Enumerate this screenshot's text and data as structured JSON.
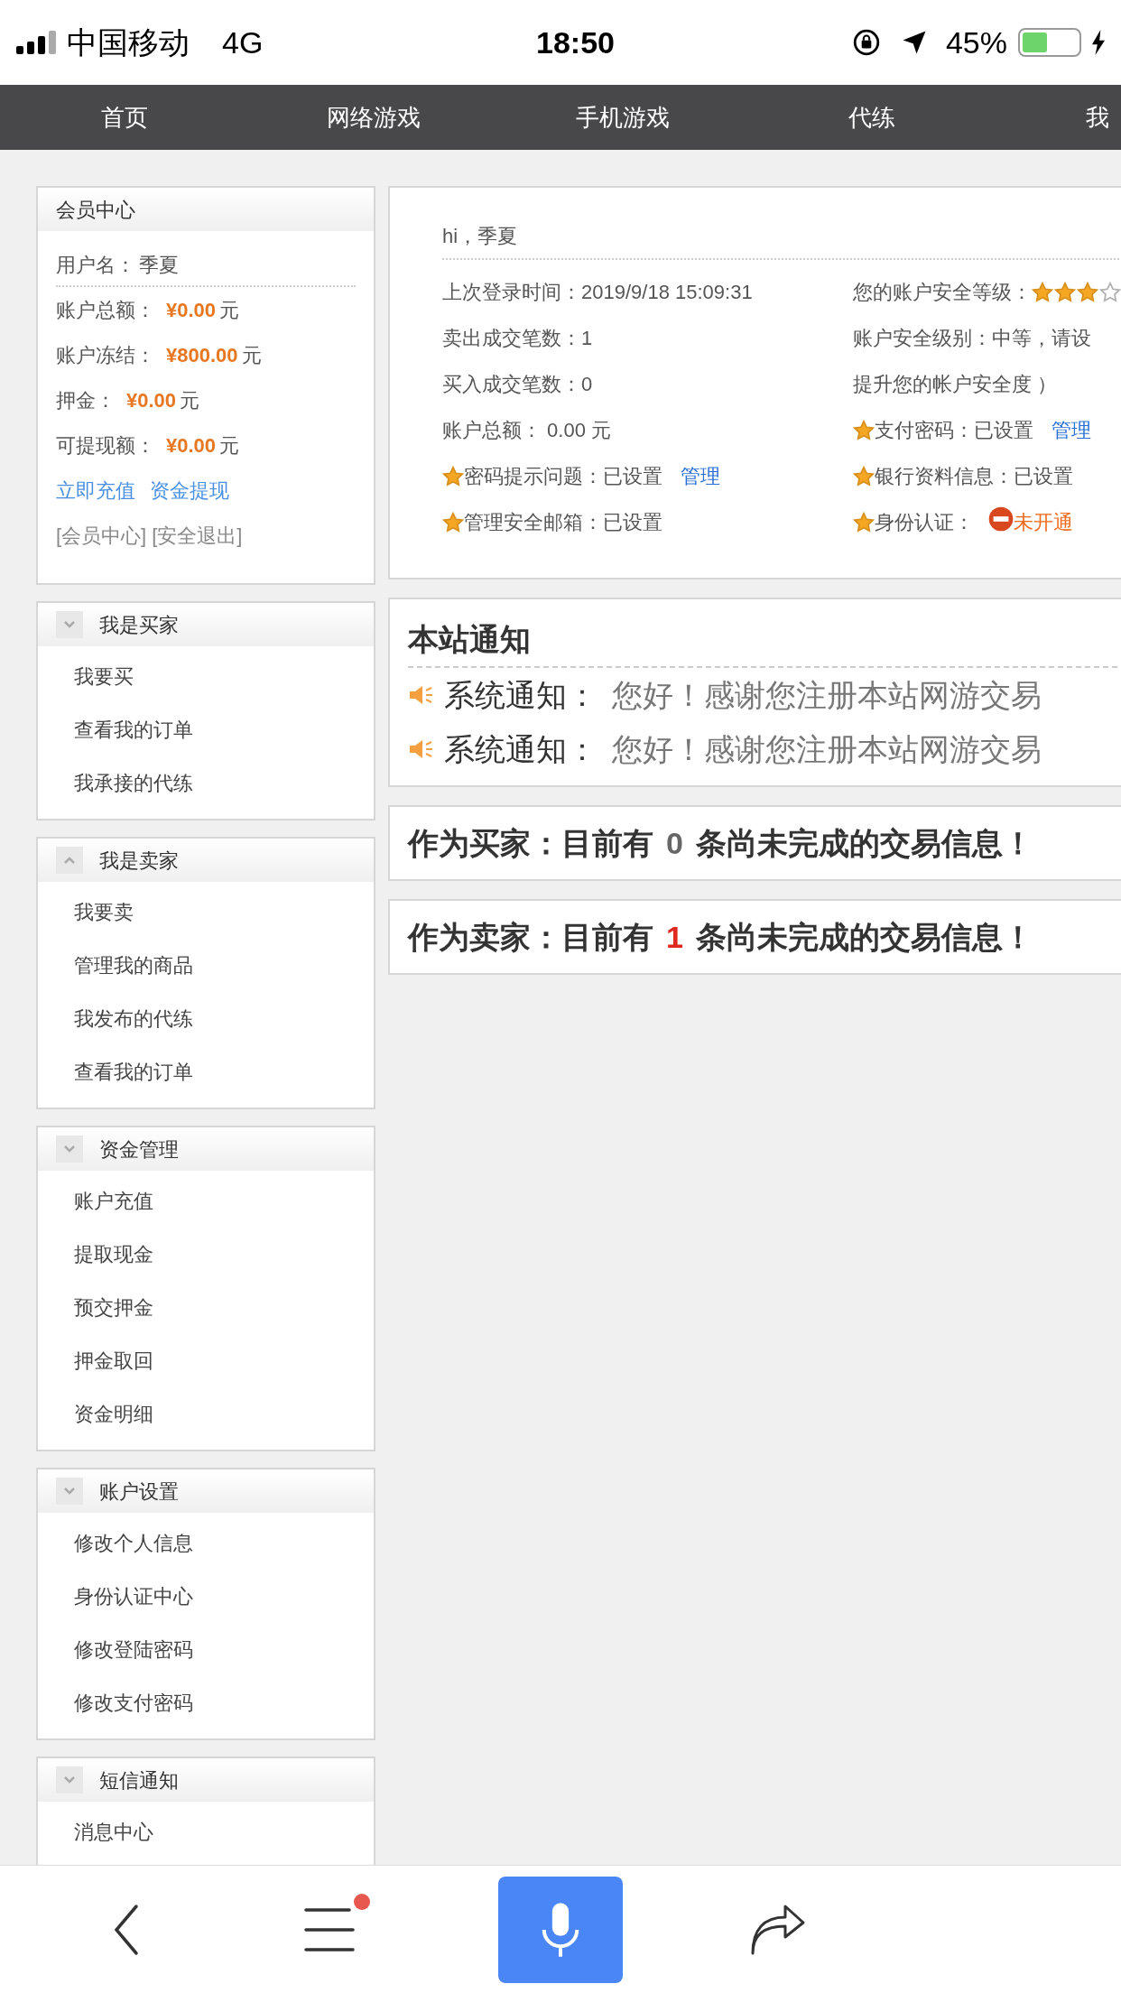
{
  "status_bar": {
    "carrier": "中国移动",
    "network": "4G",
    "time": "18:50",
    "battery_text": "45%",
    "battery": {
      "level": 0.45
    }
  },
  "nav": {
    "items": [
      {
        "label": "首页"
      },
      {
        "label": "网络游戏"
      },
      {
        "label": "手机游戏"
      },
      {
        "label": "代练"
      },
      {
        "label": "我"
      }
    ]
  },
  "member": {
    "title": "会员中心",
    "username_label": "用户名：",
    "username": "季夏",
    "balances": [
      {
        "label": "账户总额：",
        "amount": "¥0.00",
        "unit": "元"
      },
      {
        "label": "账户冻结：",
        "amount": "¥800.00",
        "unit": "元"
      },
      {
        "label": "押金：",
        "amount": "¥0.00",
        "unit": "元"
      },
      {
        "label": "可提现额：",
        "amount": "¥0.00",
        "unit": "元"
      }
    ],
    "actions": [
      "立即充值",
      "资金提现"
    ],
    "footer_links": [
      "[会员中心]",
      "[安全退出]"
    ]
  },
  "sections": [
    {
      "title": "我是买家",
      "expanded": false,
      "items": [
        "我要买",
        "查看我的订单",
        "我承接的代练"
      ]
    },
    {
      "title": "我是卖家",
      "expanded": true,
      "items": [
        "我要卖",
        "管理我的商品",
        "我发布的代练",
        "查看我的订单"
      ]
    },
    {
      "title": "资金管理",
      "expanded": false,
      "items": [
        "账户充值",
        "提取现金",
        "预交押金",
        "押金取回",
        "资金明细"
      ]
    },
    {
      "title": "账户设置",
      "expanded": false,
      "items": [
        "修改个人信息",
        "身份认证中心",
        "修改登陆密码",
        "修改支付密码"
      ]
    },
    {
      "title": "短信通知",
      "expanded": false,
      "items": [
        "消息中心"
      ]
    }
  ],
  "account": {
    "greeting": "hi，季夏",
    "left": [
      {
        "kind": "plain",
        "text": "上次登录时间：2019/9/18 15:09:31"
      },
      {
        "kind": "plain",
        "text": "卖出成交笔数：1"
      },
      {
        "kind": "plain",
        "text": "买入成交笔数：0"
      },
      {
        "kind": "plain",
        "text": "账户总额： 0.00 元"
      },
      {
        "kind": "starred",
        "text": "密码提示问题：已设置",
        "link": "管理"
      },
      {
        "kind": "starred",
        "text": "管理安全邮箱：已设置"
      }
    ],
    "right": [
      {
        "kind": "rating",
        "text": "您的账户安全等级：",
        "stars": 3
      },
      {
        "kind": "plain",
        "text": "账户安全级别：中等，请设"
      },
      {
        "kind": "plain",
        "text": "提升您的帐户安全度 ）"
      },
      {
        "kind": "starred",
        "text": "支付密码：已设置",
        "link": "管理"
      },
      {
        "kind": "starred",
        "text": "银行资料信息：已设置"
      },
      {
        "kind": "status",
        "text": "身份认证：",
        "status": "未开通"
      }
    ]
  },
  "notices": {
    "title": "本站通知",
    "items": [
      {
        "label": "系统通知：",
        "text": "您好！感谢您注册本站网游交易"
      },
      {
        "label": "系统通知：",
        "text": "您好！感谢您注册本站网游交易"
      }
    ]
  },
  "pending": [
    {
      "prefix": "作为买家：目前有",
      "count": "0",
      "color": "#666666",
      "suffix": "条尚未完成的交易信息！"
    },
    {
      "prefix": "作为卖家：目前有",
      "count": "1",
      "color": "#e02a1f",
      "suffix": "条尚未完成的交易信息！"
    }
  ],
  "bottom_bar": {
    "menu_badge": true
  }
}
